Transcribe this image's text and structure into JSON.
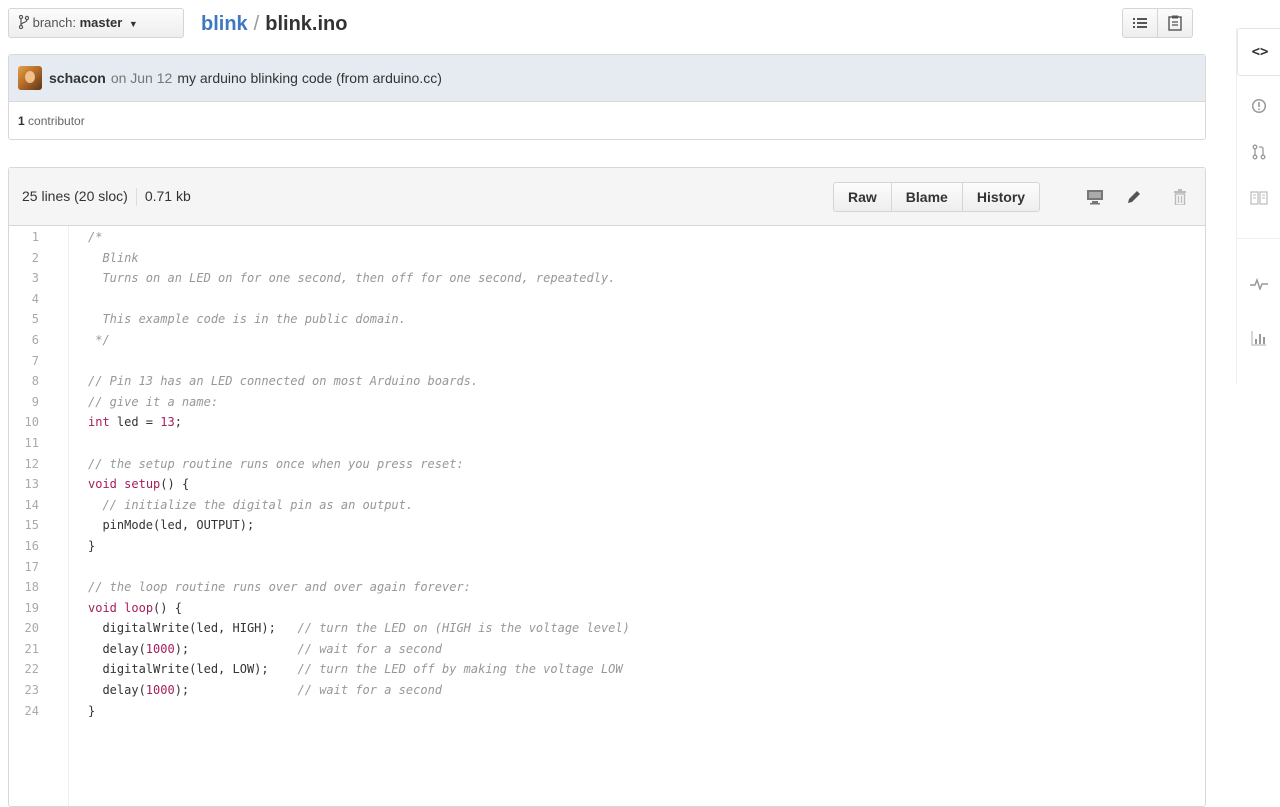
{
  "topbar": {
    "branch_prefix": "branch:",
    "branch_name": "master",
    "repo": "blink",
    "separator": "/",
    "file": "blink.ino"
  },
  "commit": {
    "author": "schacon",
    "date": "on Jun 12",
    "message": "my arduino blinking code (from arduino.cc)",
    "contributors_count": "1",
    "contributors_label": "contributor"
  },
  "file": {
    "lines_info": "25 lines (20 sloc)",
    "size": "0.71 kb",
    "buttons": {
      "raw": "Raw",
      "blame": "Blame",
      "history": "History"
    }
  },
  "code": {
    "line_numbers": [
      "1",
      "2",
      "3",
      "4",
      "5",
      "6",
      "7",
      "8",
      "9",
      "10",
      "11",
      "12",
      "13",
      "14",
      "15",
      "16",
      "17",
      "18",
      "19",
      "20",
      "21",
      "22",
      "23",
      "24"
    ],
    "lines": [
      [
        {
          "t": "/*",
          "c": "cm"
        }
      ],
      [
        {
          "t": "  Blink",
          "c": "cm"
        }
      ],
      [
        {
          "t": "  Turns on an LED on for one second, then off for one second, repeatedly.",
          "c": "cm"
        }
      ],
      [
        {
          "t": "",
          "c": "cm"
        }
      ],
      [
        {
          "t": "  This example code is in the public domain.",
          "c": "cm"
        }
      ],
      [
        {
          "t": " */",
          "c": "cm"
        }
      ],
      [
        {
          "t": "",
          "c": "plain"
        }
      ],
      [
        {
          "t": "// Pin 13 has an LED connected on most Arduino boards.",
          "c": "cm"
        }
      ],
      [
        {
          "t": "// give it a name:",
          "c": "cm"
        }
      ],
      [
        {
          "t": "int",
          "c": "kw"
        },
        {
          "t": " led = ",
          "c": "plain"
        },
        {
          "t": "13",
          "c": "kw"
        },
        {
          "t": ";",
          "c": "plain"
        }
      ],
      [
        {
          "t": "",
          "c": "plain"
        }
      ],
      [
        {
          "t": "// the setup routine runs once when you press reset:",
          "c": "cm"
        }
      ],
      [
        {
          "t": "void",
          "c": "kw"
        },
        {
          "t": " ",
          "c": "plain"
        },
        {
          "t": "setup",
          "c": "kw"
        },
        {
          "t": "() {",
          "c": "plain"
        }
      ],
      [
        {
          "t": "  // initialize the digital pin as an output.",
          "c": "cm"
        }
      ],
      [
        {
          "t": "  pinMode(led, OUTPUT);",
          "c": "plain"
        }
      ],
      [
        {
          "t": "}",
          "c": "plain"
        }
      ],
      [
        {
          "t": "",
          "c": "plain"
        }
      ],
      [
        {
          "t": "// the loop routine runs over and over again forever:",
          "c": "cm"
        }
      ],
      [
        {
          "t": "void",
          "c": "kw"
        },
        {
          "t": " ",
          "c": "plain"
        },
        {
          "t": "loop",
          "c": "kw"
        },
        {
          "t": "() {",
          "c": "plain"
        }
      ],
      [
        {
          "t": "  digitalWrite(led, HIGH);   ",
          "c": "plain"
        },
        {
          "t": "// turn the LED on (HIGH is the voltage level)",
          "c": "cm"
        }
      ],
      [
        {
          "t": "  delay(",
          "c": "plain"
        },
        {
          "t": "1000",
          "c": "kw"
        },
        {
          "t": ");               ",
          "c": "plain"
        },
        {
          "t": "// wait for a second",
          "c": "cm"
        }
      ],
      [
        {
          "t": "  digitalWrite(led, LOW);    ",
          "c": "plain"
        },
        {
          "t": "// turn the LED off by making the voltage LOW",
          "c": "cm"
        }
      ],
      [
        {
          "t": "  delay(",
          "c": "plain"
        },
        {
          "t": "1000",
          "c": "kw"
        },
        {
          "t": ");               ",
          "c": "plain"
        },
        {
          "t": "// wait for a second",
          "c": "cm"
        }
      ],
      [
        {
          "t": "}",
          "c": "plain"
        }
      ]
    ]
  },
  "icons": {
    "branch": "branch-icon",
    "list": "list-icon",
    "clipboard": "clipboard-icon",
    "desktop": "desktop-icon",
    "pencil": "pencil-icon",
    "trash": "trash-icon",
    "rail": [
      "code-icon",
      "issue-icon",
      "pull-request-icon",
      "wiki-icon",
      "pulse-icon",
      "graph-icon"
    ]
  },
  "colors": {
    "link": "#4078c0",
    "commit_bg": "#e6ebf1",
    "keyword": "#a71d5d",
    "comment": "#969896"
  }
}
